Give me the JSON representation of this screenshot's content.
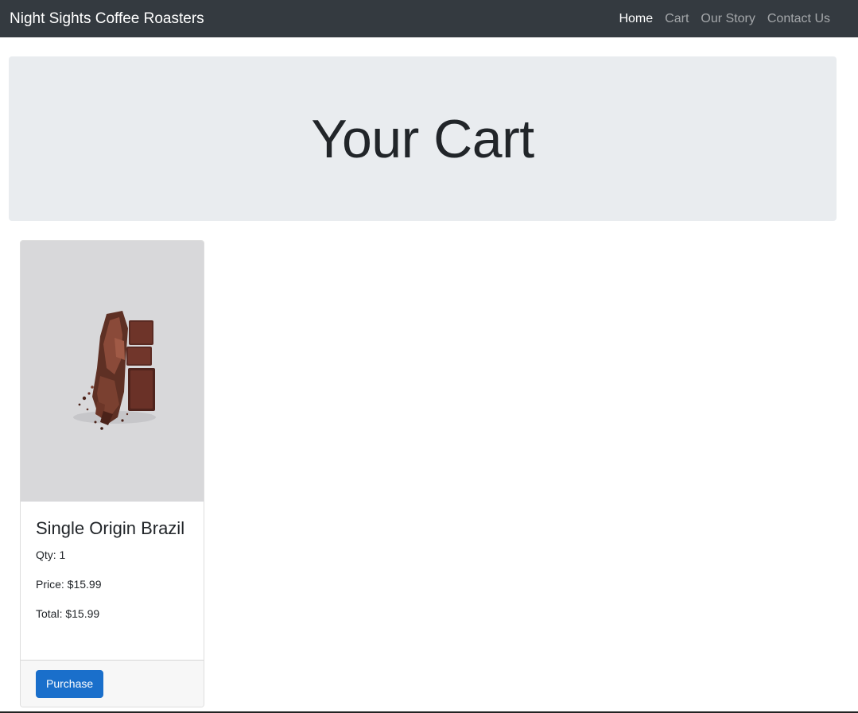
{
  "nav": {
    "brand": "Night Sights Coffee Roasters",
    "links": [
      {
        "label": "Home",
        "active": true
      },
      {
        "label": "Cart",
        "active": false
      },
      {
        "label": "Our Story",
        "active": false
      },
      {
        "label": "Contact Us",
        "active": false
      }
    ]
  },
  "jumbotron": {
    "heading": "Your Cart"
  },
  "cart_items": [
    {
      "image": "chocolate-pieces-image",
      "title": "Single Origin Brazil",
      "qty_text": "Qty: 1",
      "price_text": "Price: $15.99",
      "total_text": "Total: $15.99",
      "button_label": "Purchase"
    }
  ],
  "colors": {
    "navbar_bg": "#343a40",
    "jumbotron_bg": "#e9ecef",
    "primary": "#1a6fcb"
  }
}
